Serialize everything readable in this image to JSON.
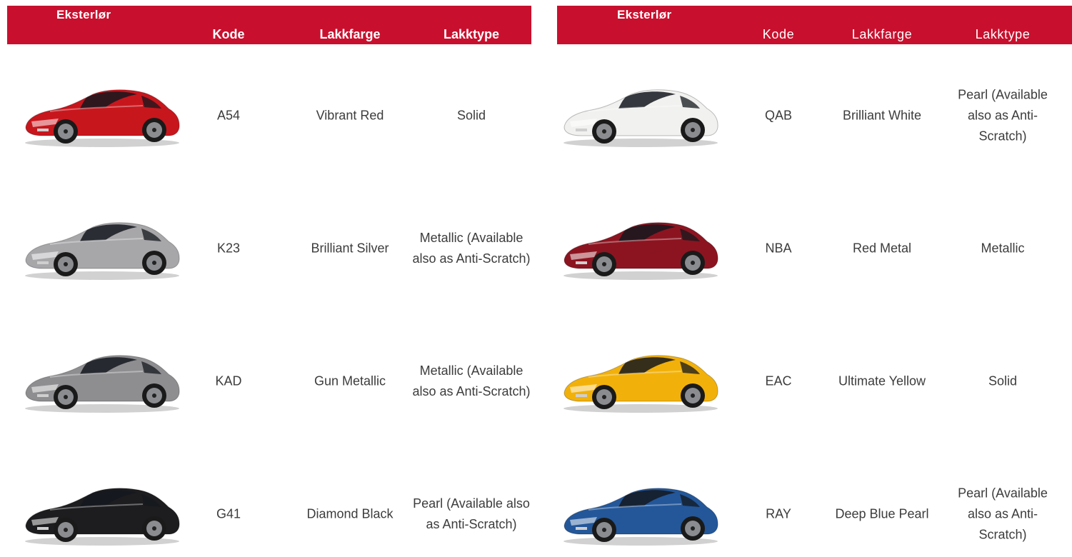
{
  "left": {
    "title": "Eksterlør",
    "headers": {
      "code": "Kode",
      "color": "Lakkfarge",
      "type": "Lakktype"
    },
    "rows": [
      {
        "code": "A54",
        "color": "Vibrant Red",
        "type": "Solid",
        "paint": "#c8161d",
        "icon": "red-car-image"
      },
      {
        "code": "K23",
        "color": "Brilliant Silver",
        "type": "Metallic (Available also as Anti-Scratch)",
        "paint": "#a7a7aa",
        "icon": "silver-car-image"
      },
      {
        "code": "KAD",
        "color": "Gun Metallic",
        "type": "Metallic (Available also as Anti-Scratch)",
        "paint": "#8e8e91",
        "icon": "gun-metallic-car-image"
      },
      {
        "code": "G41",
        "color": "Diamond Black",
        "type": "Pearl (Available also as Anti-Scratch)",
        "paint": "#1d1d1f",
        "icon": "black-car-image"
      }
    ]
  },
  "right": {
    "title": "Eksterlør",
    "headers": {
      "code": "Kode",
      "color": "Lakkfarge",
      "type": "Lakktype"
    },
    "rows": [
      {
        "code": "QAB",
        "color": "Brilliant White",
        "type": "Pearl (Available also as Anti-Scratch)",
        "paint": "#f1f1ef",
        "icon": "white-car-image"
      },
      {
        "code": "NBA",
        "color": "Red Metal",
        "type": "Metallic",
        "paint": "#8c1420",
        "icon": "red-metal-car-image"
      },
      {
        "code": "EAC",
        "color": "Ultimate Yellow",
        "type": "Solid",
        "paint": "#f2b10a",
        "icon": "yellow-car-image"
      },
      {
        "code": "RAY",
        "color": "Deep Blue Pearl",
        "type": "Pearl (Available also as Anti-Scratch)",
        "paint": "#23579a",
        "icon": "blue-car-image"
      }
    ]
  },
  "colors": {
    "header": "#c8102e",
    "text": "#3c3c3c"
  }
}
